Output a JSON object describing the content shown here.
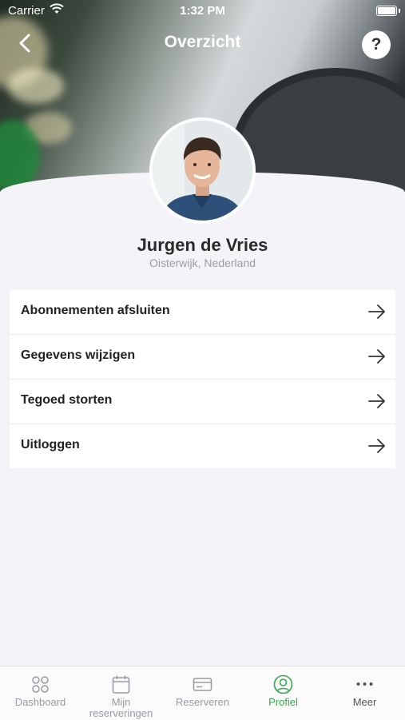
{
  "status_bar": {
    "carrier": "Carrier",
    "time": "1:32 PM"
  },
  "header": {
    "title": "Overzicht",
    "help_label": "?"
  },
  "profile": {
    "name": "Jurgen de Vries",
    "location": "Oisterwijk, Nederland"
  },
  "menu": [
    {
      "label": "Abonnementen afsluiten"
    },
    {
      "label": "Gegevens wijzigen"
    },
    {
      "label": "Tegoed storten"
    },
    {
      "label": "Uitloggen"
    }
  ],
  "tabbar": {
    "active_color": "#3aa54a",
    "items": [
      {
        "label": "Dashboard",
        "icon": "dashboard-icon"
      },
      {
        "label": "Mijn reserveringen",
        "icon": "calendar-icon"
      },
      {
        "label": "Reserveren",
        "icon": "card-icon"
      },
      {
        "label": "Profiel",
        "icon": "profile-icon"
      },
      {
        "label": "Meer",
        "icon": "more-icon"
      }
    ]
  }
}
